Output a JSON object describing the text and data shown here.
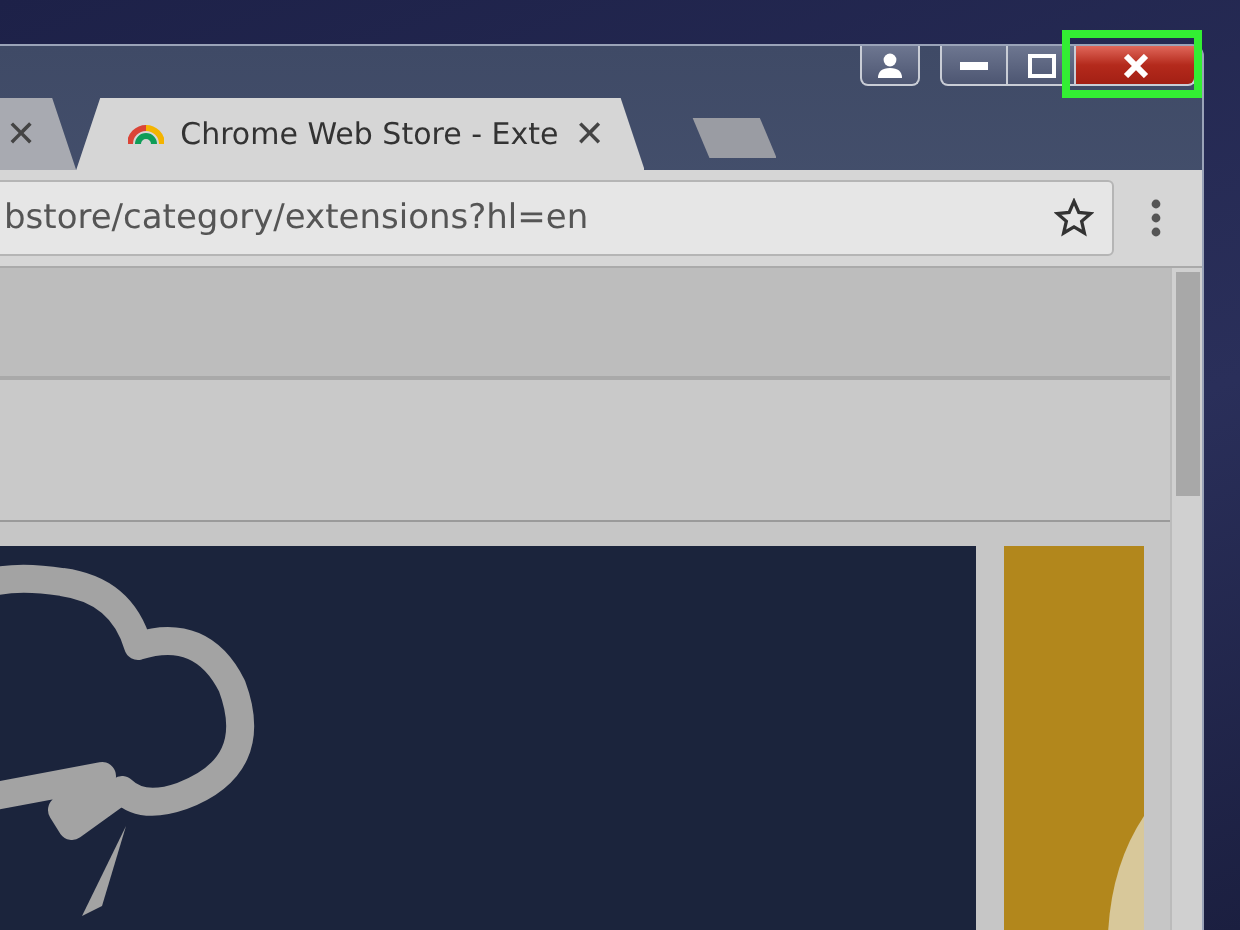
{
  "window_controls": {
    "close": {
      "highlighted": true
    }
  },
  "tabs": [
    {
      "close_glyph": "✕",
      "selected": false
    },
    {
      "title": "Chrome Web Store - Exte",
      "close_glyph": "✕",
      "selected": true
    }
  ],
  "address_bar": {
    "value": "bstore/category/extensions?hl=en"
  }
}
